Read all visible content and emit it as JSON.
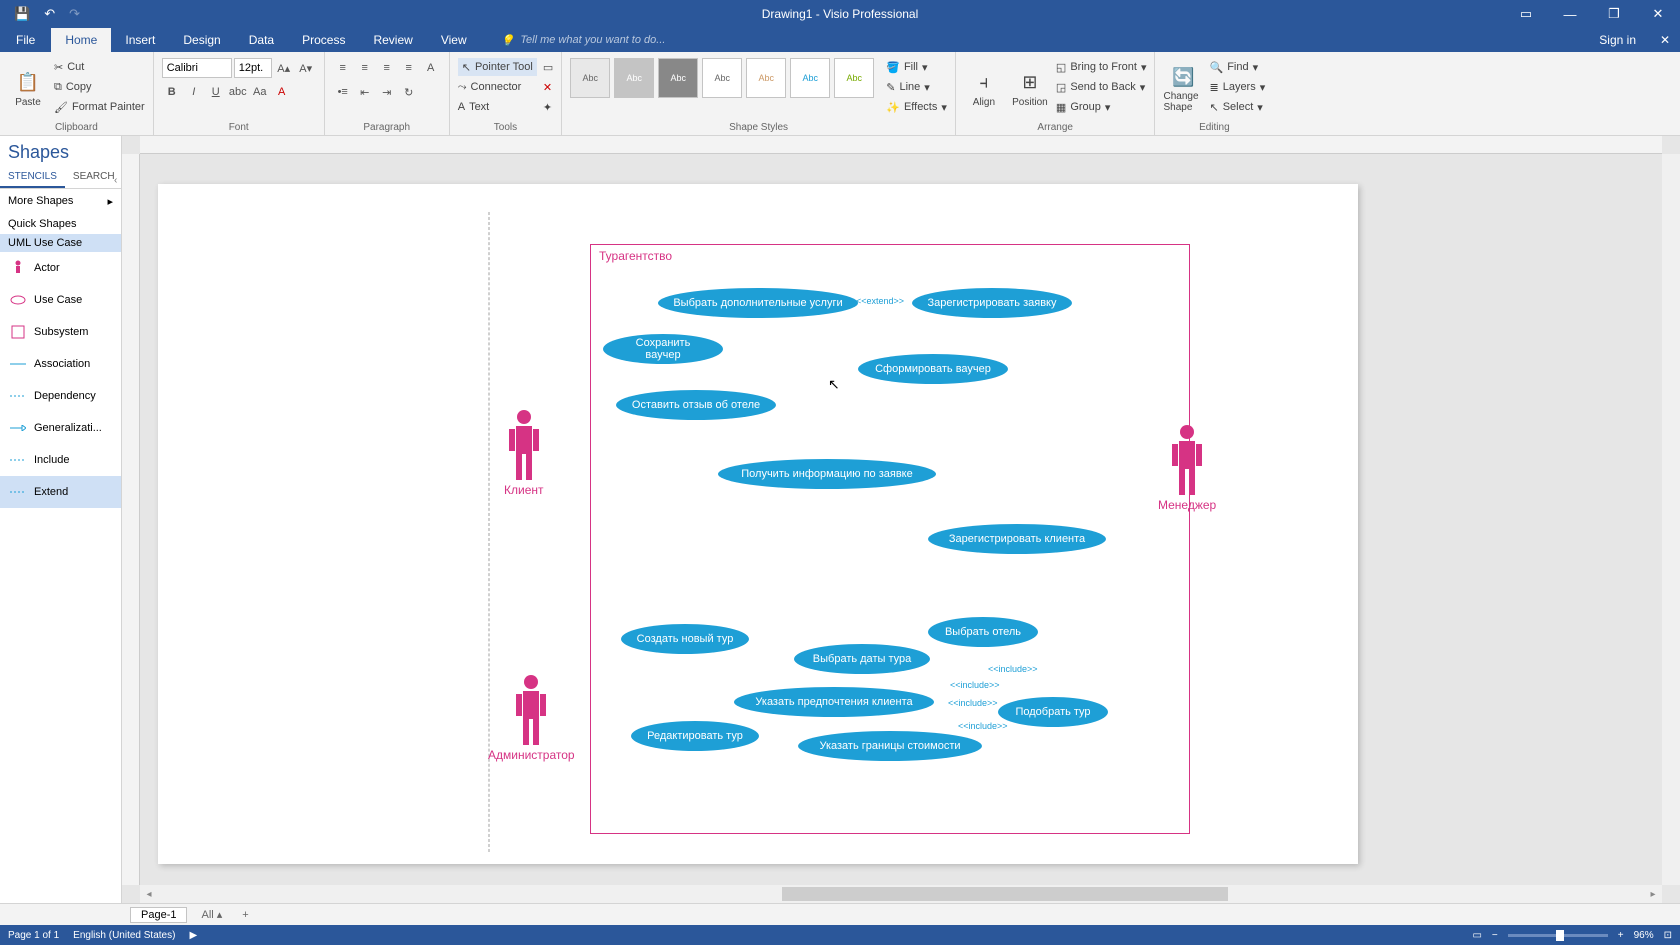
{
  "title": "Drawing1 - Visio Professional",
  "qat": {
    "save": "💾",
    "undo": "↶",
    "redo": "↷"
  },
  "wincontrols": {
    "min": "—",
    "max": "❐",
    "close": "✕",
    "ribmin": "▭"
  },
  "signin": "Sign in",
  "tabs": {
    "file": "File",
    "home": "Home",
    "insert": "Insert",
    "design": "Design",
    "data": "Data",
    "process": "Process",
    "review": "Review",
    "view": "View"
  },
  "tellme": "Tell me what you want to do...",
  "ribbon": {
    "clipboard": {
      "label": "Clipboard",
      "paste": "Paste",
      "cut": "Cut",
      "copy": "Copy",
      "fmtpaint": "Format Painter"
    },
    "font": {
      "label": "Font",
      "name": "Calibri",
      "size": "12pt."
    },
    "para": {
      "label": "Paragraph"
    },
    "tools": {
      "label": "Tools",
      "pointer": "Pointer Tool",
      "connector": "Connector",
      "text": "Text",
      "shape": "▭",
      "x": "✕"
    },
    "styles": {
      "label": "Shape Styles",
      "fill": "Fill",
      "line": "Line",
      "effects": "Effects",
      "abc": "Abc"
    },
    "arrange": {
      "label": "Arrange",
      "align": "Align",
      "position": "Position",
      "front": "Bring to Front",
      "back": "Send to Back",
      "group": "Group"
    },
    "editing": {
      "label": "Editing",
      "change": "Change Shape",
      "find": "Find",
      "layers": "Layers",
      "select": "Select"
    }
  },
  "shapespane": {
    "title": "Shapes",
    "stencils": "STENCILS",
    "search": "SEARCH",
    "more": "More Shapes",
    "quick": "Quick Shapes",
    "stencil": "UML Use Case",
    "items": [
      {
        "name": "Actor"
      },
      {
        "name": "Use Case"
      },
      {
        "name": "Subsystem"
      },
      {
        "name": "Association"
      },
      {
        "name": "Dependency"
      },
      {
        "name": "Generalizati..."
      },
      {
        "name": "Include"
      },
      {
        "name": "Extend"
      }
    ]
  },
  "diagram": {
    "system": "Турагентство",
    "actors": {
      "client": "Клиент",
      "admin": "Администратор",
      "manager": "Менеджер"
    },
    "usecases": {
      "uc1": "Выбрать дополнительные услуги",
      "uc2": "Зарегистрировать заявку",
      "uc3": "Сохранить ваучер",
      "uc4": "Сформировать ваучер",
      "uc5": "Оставить отзыв об отеле",
      "uc6": "Получить информацию по заявке",
      "uc7": "Зарегистрировать клиента",
      "uc8": "Выбрать отель",
      "uc9": "Создать новый тур",
      "uc10": "Выбрать даты тура",
      "uc11": "Указать предпочтения клиента",
      "uc12": "Подобрать тур",
      "uc13": "Редактировать тур",
      "uc14": "Указать границы стоимости"
    },
    "labels": {
      "extend": "<<extend>>",
      "include": "<<include>>"
    }
  },
  "pagetabs": {
    "page1": "Page-1",
    "all": "All",
    "add": "+"
  },
  "status": {
    "page": "Page 1 of 1",
    "lang": "English (United States)",
    "zoom": "96%",
    "fit": "⊡"
  }
}
